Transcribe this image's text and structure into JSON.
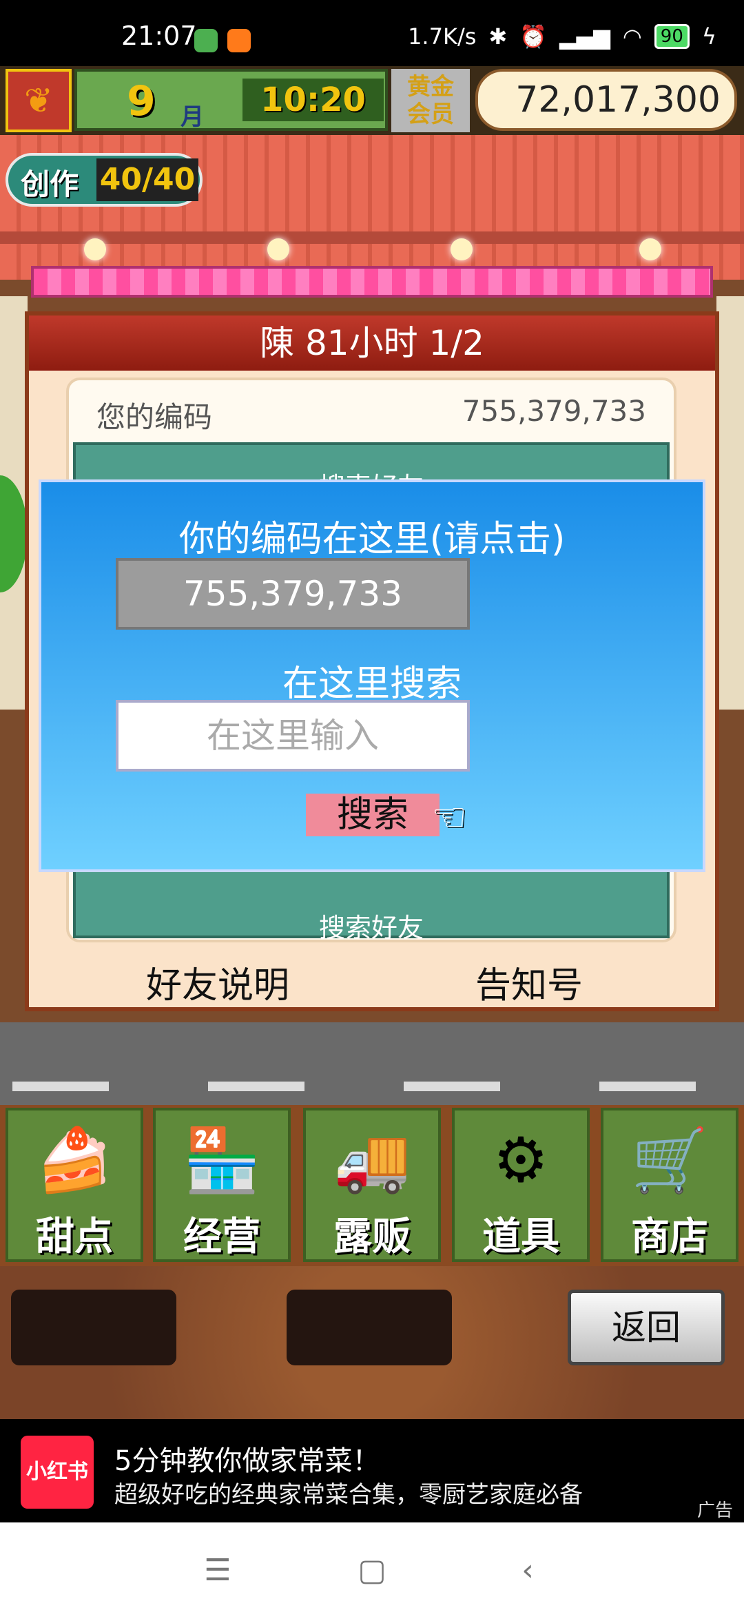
{
  "status_bar": {
    "time": "21:07",
    "net_speed": "1.7K/s",
    "battery": "90",
    "icons": [
      "app-icon-green",
      "app-icon-orange",
      "bluetooth-icon",
      "alarm-icon",
      "signal-icon",
      "wifi-icon",
      "battery-icon",
      "charging-icon"
    ]
  },
  "hud": {
    "month_number": "9",
    "month_unit": "月",
    "clock": "10:20",
    "member_label_line1": "黄金",
    "member_label_line2": "会员",
    "money": "72,017,300 G"
  },
  "create_badge": {
    "label": "创作",
    "value": "40/40"
  },
  "friend_panel": {
    "title": "陳  81小时 1/2",
    "your_code_label": "您的编码",
    "your_code_value": "755,379,733",
    "behind_top_text": "搜索好友",
    "behind_bottom_text": "搜索好友",
    "footer_left": "好友说明",
    "footer_right": "告知号"
  },
  "dialog": {
    "title": "你的编码在这里(请点击)",
    "code_value": "755,379,733",
    "search_label": "在这里搜索",
    "input_placeholder": "在这里输入",
    "search_button": "搜索"
  },
  "menu": [
    {
      "label": "甜点",
      "icon": "cake-icon"
    },
    {
      "label": "经营",
      "icon": "shop-icon"
    },
    {
      "label": "露贩",
      "icon": "food-truck-icon"
    },
    {
      "label": "道具",
      "icon": "items-icon"
    },
    {
      "label": "商店",
      "icon": "cart-icon"
    }
  ],
  "back_button": "返回",
  "ad": {
    "logo_text": "小红书",
    "title": "5分钟教你做家常菜！",
    "subtitle": "超级好吃的经典家常菜合集，零厨艺家庭必备",
    "tag": "广告"
  },
  "colors": {
    "dialog_top": "#1a8de8",
    "dialog_bottom": "#6fd0ff",
    "panel_title": "#c0392b",
    "search_button": "#f08b9a",
    "teal": "#4f9e8c"
  }
}
